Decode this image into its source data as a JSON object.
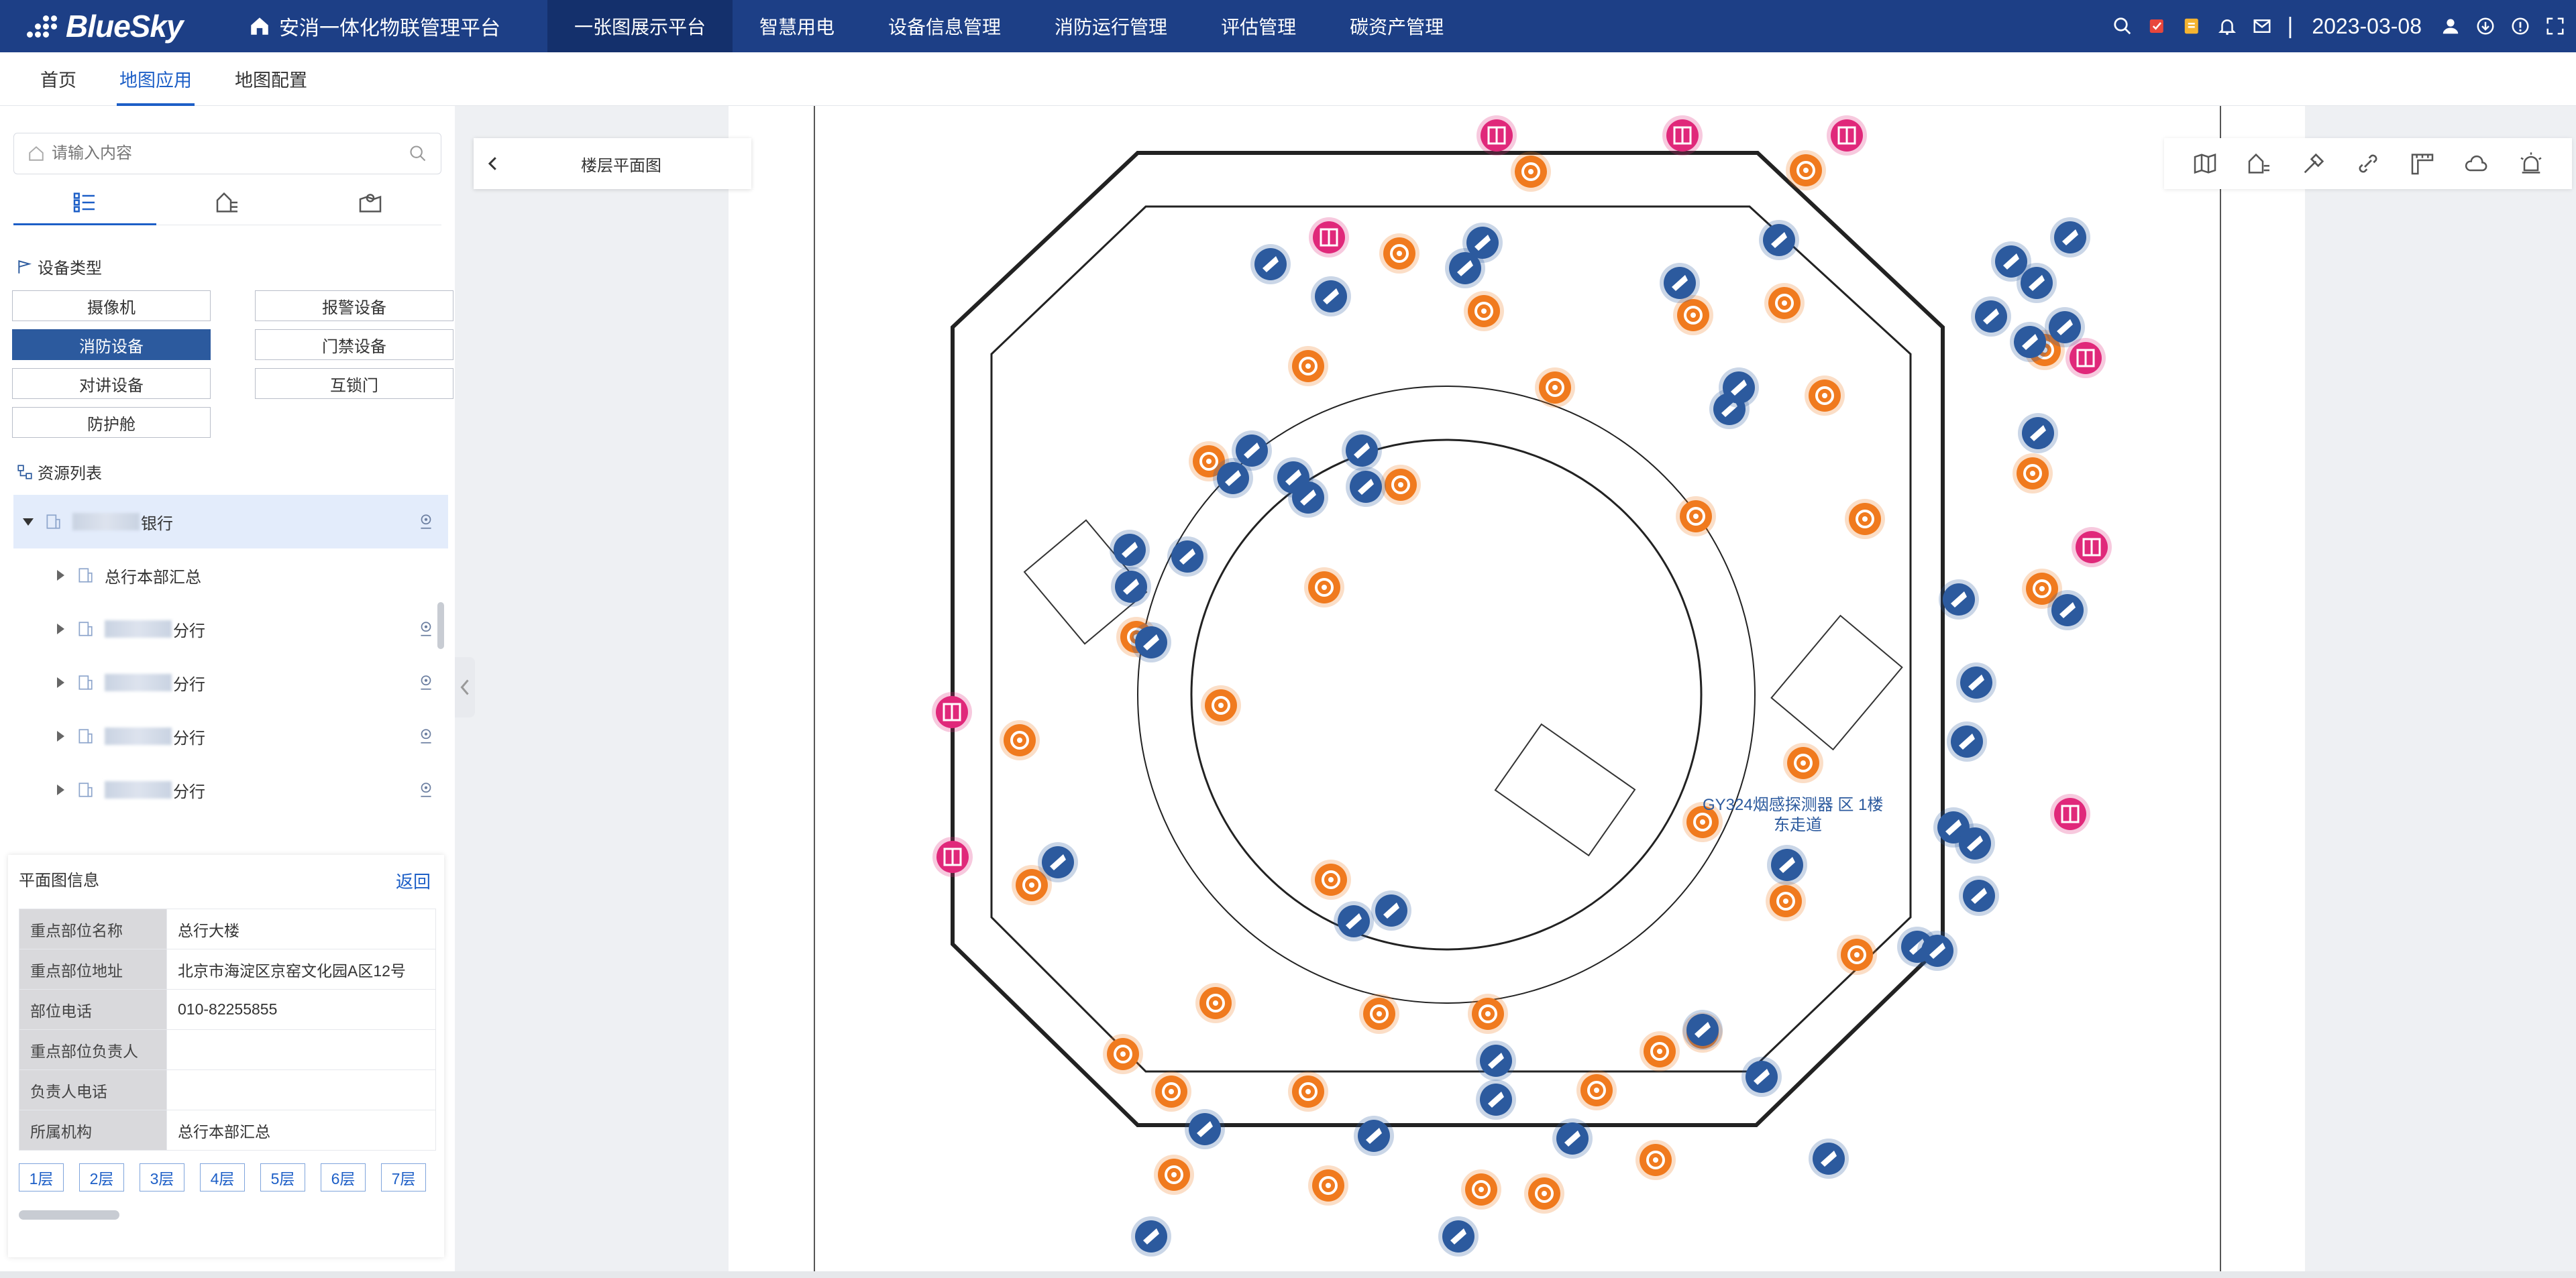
{
  "header": {
    "logo_text": "BlueSky",
    "platform_title": "安消一体化物联管理平台",
    "nav": [
      {
        "label": "一张图展示平台",
        "active": true
      },
      {
        "label": "智慧用电",
        "active": false
      },
      {
        "label": "设备信息管理",
        "active": false
      },
      {
        "label": "消防运行管理",
        "active": false
      },
      {
        "label": "评估管理",
        "active": false
      },
      {
        "label": "碳资产管理",
        "active": false
      }
    ],
    "date": "2023-03-08",
    "separator": "|"
  },
  "subtabs": [
    {
      "label": "首页",
      "active": false
    },
    {
      "label": "地图应用",
      "active": true
    },
    {
      "label": "地图配置",
      "active": false
    }
  ],
  "sidebar": {
    "search_placeholder": "请输入内容",
    "device_type_title": "设备类型",
    "device_types": [
      {
        "label": "摄像机",
        "active": false
      },
      {
        "label": "报警设备",
        "active": false
      },
      {
        "label": "消防设备",
        "active": true
      },
      {
        "label": "门禁设备",
        "active": false
      },
      {
        "label": "对讲设备",
        "active": false
      },
      {
        "label": "互锁门",
        "active": false
      },
      {
        "label": "防护舱",
        "active": false
      }
    ],
    "resource_title": "资源列表",
    "tree": [
      {
        "label": "银行",
        "level": 0,
        "expanded": true,
        "selected": true
      },
      {
        "label": "总行本部汇总",
        "level": 1
      },
      {
        "label": "分行",
        "level": 1
      },
      {
        "label": "分行",
        "level": 1
      },
      {
        "label": "分行",
        "level": 1
      },
      {
        "label": "分行",
        "level": 1
      }
    ]
  },
  "floor_info": {
    "title": "平面图信息",
    "back_label": "返回",
    "rows": [
      {
        "key": "重点部位名称",
        "value": "总行大楼"
      },
      {
        "key": "重点部位地址",
        "value": "北京市海淀区京窑文化园A区12号"
      },
      {
        "key": "部位电话",
        "value": "010-82255855"
      },
      {
        "key": "重点部位负责人",
        "value": ""
      },
      {
        "key": "负责人电话",
        "value": ""
      },
      {
        "key": "所属机构",
        "value": "总行本部汇总"
      }
    ],
    "floors": [
      "1层",
      "2层",
      "3层",
      "4层",
      "5层",
      "6层",
      "7层"
    ]
  },
  "map": {
    "panel_label": "楼层平面图",
    "annotation": "GY324烟感探测器 区 1楼",
    "annotation_line2": "东走道",
    "colors": {
      "hydrant": "#f07a1e",
      "camera": "#2c5a9e",
      "door": "#e0287a",
      "nav_bg": "#1d3f86"
    }
  }
}
